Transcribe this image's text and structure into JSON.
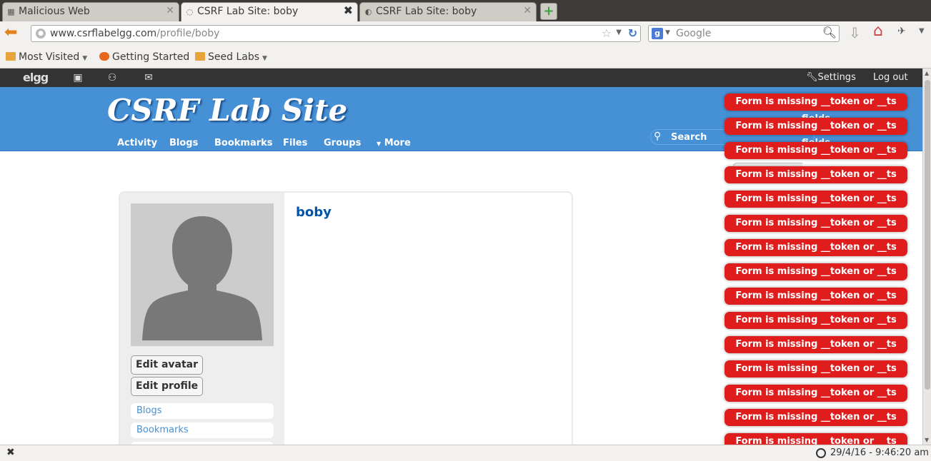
{
  "browser": {
    "tabs": [
      {
        "title": "Malicious Web",
        "active": false
      },
      {
        "title": "CSRF Lab Site: boby",
        "active": true
      },
      {
        "title": "CSRF Lab Site: boby",
        "active": false
      }
    ],
    "url_domain": "www.csrflabelgg.com",
    "url_path": "/profile/boby",
    "search_placeholder": "Google",
    "bookmarks": [
      "Most Visited",
      "Getting Started",
      "Seed Labs"
    ],
    "status_time": "29/4/16 - 9:46:20 am"
  },
  "topbar": {
    "logo": "elgg",
    "settings": "Settings",
    "logout": "Log out"
  },
  "site": {
    "name": "CSRF Lab Site",
    "menu": [
      "Activity",
      "Blogs",
      "Bookmarks",
      "Files",
      "Groups",
      "More"
    ],
    "more_caret": "▼",
    "search_label": "Search"
  },
  "profile": {
    "name": "boby",
    "edit_avatar": "Edit avatar",
    "edit_profile": "Edit profile",
    "links": [
      "Blogs",
      "Bookmarks"
    ]
  },
  "error_message": "Form is missing __token or __ts fields",
  "error_count": 15,
  "colors": {
    "header_blue": "#4690d6",
    "error_red": "#e01d1d",
    "topbar": "#333333"
  }
}
